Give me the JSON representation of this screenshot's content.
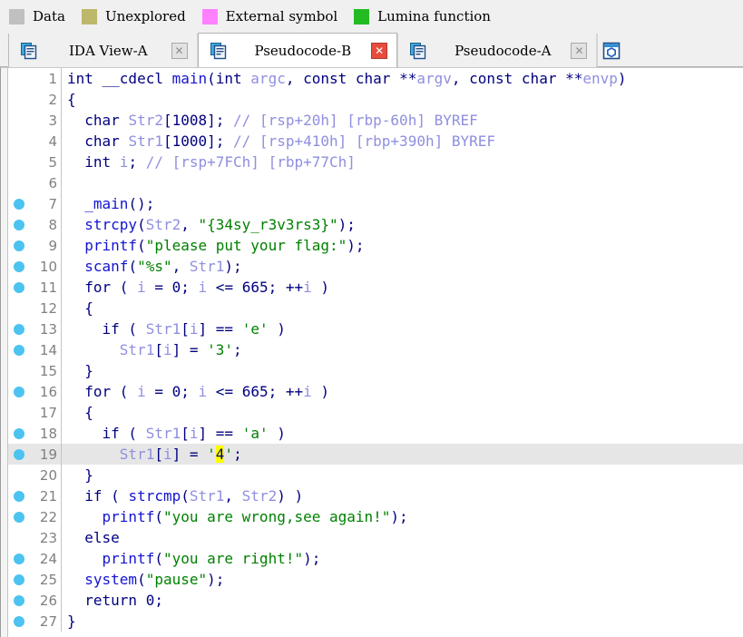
{
  "legend": {
    "items": [
      {
        "label": "Data",
        "color": "#c0c0c0",
        "icon": "color-swatch"
      },
      {
        "label": "Unexplored",
        "color": "#bdb76b",
        "icon": "color-swatch"
      },
      {
        "label": "External symbol",
        "color": "#ff80ff",
        "icon": "color-swatch"
      },
      {
        "label": "Lumina function",
        "color": "#22bb22",
        "icon": "color-swatch"
      }
    ]
  },
  "tabs": [
    {
      "title": "IDA View-A",
      "icon": "document-pages-icon",
      "close_label": "✕",
      "active": false,
      "close_style": "gray"
    },
    {
      "title": "Pseudocode-B",
      "icon": "document-pages-icon",
      "close_label": "✕",
      "active": true,
      "close_style": "red"
    },
    {
      "title": "Pseudocode-A",
      "icon": "document-pages-icon",
      "close_label": "✕",
      "active": false,
      "close_style": "gray"
    },
    {
      "title": "",
      "icon": "hex-view-icon",
      "close_label": "",
      "active": false,
      "close_style": "none"
    }
  ],
  "editor": {
    "selected_line": 19,
    "highlighted_token": "4",
    "lines": [
      {
        "n": 1,
        "bp": false,
        "text": "int __cdecl main(int argc, const char **argv, const char **envp)"
      },
      {
        "n": 2,
        "bp": false,
        "text": "{"
      },
      {
        "n": 3,
        "bp": false,
        "text": "  char Str2[1008]; // [rsp+20h] [rbp-60h] BYREF"
      },
      {
        "n": 4,
        "bp": false,
        "text": "  char Str1[1000]; // [rsp+410h] [rbp+390h] BYREF"
      },
      {
        "n": 5,
        "bp": false,
        "text": "  int i; // [rsp+7FCh] [rbp+77Ch]"
      },
      {
        "n": 6,
        "bp": false,
        "text": ""
      },
      {
        "n": 7,
        "bp": true,
        "text": "  _main();"
      },
      {
        "n": 8,
        "bp": true,
        "text": "  strcpy(Str2, \"{34sy_r3v3rs3}\");"
      },
      {
        "n": 9,
        "bp": true,
        "text": "  printf(\"please put your flag:\");"
      },
      {
        "n": 10,
        "bp": true,
        "text": "  scanf(\"%s\", Str1);"
      },
      {
        "n": 11,
        "bp": true,
        "text": "  for ( i = 0; i <= 665; ++i )"
      },
      {
        "n": 12,
        "bp": false,
        "text": "  {"
      },
      {
        "n": 13,
        "bp": true,
        "text": "    if ( Str1[i] == 'e' )"
      },
      {
        "n": 14,
        "bp": true,
        "text": "      Str1[i] = '3';"
      },
      {
        "n": 15,
        "bp": false,
        "text": "  }"
      },
      {
        "n": 16,
        "bp": true,
        "text": "  for ( i = 0; i <= 665; ++i )"
      },
      {
        "n": 17,
        "bp": false,
        "text": "  {"
      },
      {
        "n": 18,
        "bp": true,
        "text": "    if ( Str1[i] == 'a' )"
      },
      {
        "n": 19,
        "bp": true,
        "text": "      Str1[i] = '4';"
      },
      {
        "n": 20,
        "bp": false,
        "text": "  }"
      },
      {
        "n": 21,
        "bp": true,
        "text": "  if ( strcmp(Str1, Str2) )"
      },
      {
        "n": 22,
        "bp": true,
        "text": "    printf(\"you are wrong,see again!\");"
      },
      {
        "n": 23,
        "bp": false,
        "text": "  else"
      },
      {
        "n": 24,
        "bp": true,
        "text": "    printf(\"you are right!\");"
      },
      {
        "n": 25,
        "bp": true,
        "text": "  system(\"pause\");"
      },
      {
        "n": 26,
        "bp": true,
        "text": "  return 0;"
      },
      {
        "n": 27,
        "bp": true,
        "text": "}"
      }
    ],
    "rich": {
      "1": [
        [
          "kw",
          "int "
        ],
        [
          "kw",
          "__cdecl "
        ],
        [
          "fn",
          "main"
        ],
        [
          "pun",
          "("
        ],
        [
          "kw",
          "int "
        ],
        [
          "var",
          "argc"
        ],
        [
          "pun",
          ", "
        ],
        [
          "kw",
          "const char "
        ],
        [
          "pun",
          "**"
        ],
        [
          "var",
          "argv"
        ],
        [
          "pun",
          ", "
        ],
        [
          "kw",
          "const char "
        ],
        [
          "pun",
          "**"
        ],
        [
          "var",
          "envp"
        ],
        [
          "pun",
          ")"
        ]
      ],
      "2": [
        [
          "pun",
          "{"
        ]
      ],
      "3": [
        [
          "pun",
          "  "
        ],
        [
          "kw",
          "char "
        ],
        [
          "var",
          "Str2"
        ],
        [
          "pun",
          "[1008]; "
        ],
        [
          "cmt",
          "// [rsp+20h] [rbp-60h] BYREF"
        ]
      ],
      "4": [
        [
          "pun",
          "  "
        ],
        [
          "kw",
          "char "
        ],
        [
          "var",
          "Str1"
        ],
        [
          "pun",
          "[1000]; "
        ],
        [
          "cmt",
          "// [rsp+410h] [rbp+390h] BYREF"
        ]
      ],
      "5": [
        [
          "pun",
          "  "
        ],
        [
          "kw",
          "int "
        ],
        [
          "var",
          "i"
        ],
        [
          "pun",
          "; "
        ],
        [
          "cmt",
          "// [rsp+7FCh] [rbp+77Ch]"
        ]
      ],
      "6": [
        [
          "pun",
          ""
        ]
      ],
      "7": [
        [
          "pun",
          "  "
        ],
        [
          "fn",
          "_main"
        ],
        [
          "pun",
          "();"
        ]
      ],
      "8": [
        [
          "pun",
          "  "
        ],
        [
          "fn",
          "strcpy"
        ],
        [
          "pun",
          "("
        ],
        [
          "var",
          "Str2"
        ],
        [
          "pun",
          ", "
        ],
        [
          "str",
          "\"{34sy_r3v3rs3}\""
        ],
        [
          "pun",
          ");"
        ]
      ],
      "9": [
        [
          "pun",
          "  "
        ],
        [
          "fn",
          "printf"
        ],
        [
          "pun",
          "("
        ],
        [
          "str",
          "\"please put your flag:\""
        ],
        [
          "pun",
          ");"
        ]
      ],
      "10": [
        [
          "pun",
          "  "
        ],
        [
          "fn",
          "scanf"
        ],
        [
          "pun",
          "("
        ],
        [
          "str",
          "\"%s\""
        ],
        [
          "pun",
          ", "
        ],
        [
          "var",
          "Str1"
        ],
        [
          "pun",
          ");"
        ]
      ],
      "11": [
        [
          "pun",
          "  "
        ],
        [
          "kw",
          "for"
        ],
        [
          "pun",
          " ( "
        ],
        [
          "var",
          "i"
        ],
        [
          "pun",
          " = "
        ],
        [
          "num",
          "0"
        ],
        [
          "pun",
          "; "
        ],
        [
          "var",
          "i"
        ],
        [
          "pun",
          " <= "
        ],
        [
          "num",
          "665"
        ],
        [
          "pun",
          "; ++"
        ],
        [
          "var",
          "i"
        ],
        [
          "pun",
          " )"
        ]
      ],
      "12": [
        [
          "pun",
          "  {"
        ]
      ],
      "13": [
        [
          "pun",
          "    "
        ],
        [
          "kw",
          "if"
        ],
        [
          "pun",
          " ( "
        ],
        [
          "var",
          "Str1"
        ],
        [
          "pun",
          "["
        ],
        [
          "var",
          "i"
        ],
        [
          "pun",
          "] == "
        ],
        [
          "str",
          "'e'"
        ],
        [
          "pun",
          " )"
        ]
      ],
      "14": [
        [
          "pun",
          "      "
        ],
        [
          "var",
          "Str1"
        ],
        [
          "pun",
          "["
        ],
        [
          "var",
          "i"
        ],
        [
          "pun",
          "] = "
        ],
        [
          "str",
          "'3'"
        ],
        [
          "pun",
          ";"
        ]
      ],
      "15": [
        [
          "pun",
          "  }"
        ]
      ],
      "16": [
        [
          "pun",
          "  "
        ],
        [
          "kw",
          "for"
        ],
        [
          "pun",
          " ( "
        ],
        [
          "var",
          "i"
        ],
        [
          "pun",
          " = "
        ],
        [
          "num",
          "0"
        ],
        [
          "pun",
          "; "
        ],
        [
          "var",
          "i"
        ],
        [
          "pun",
          " <= "
        ],
        [
          "num",
          "665"
        ],
        [
          "pun",
          "; ++"
        ],
        [
          "var",
          "i"
        ],
        [
          "pun",
          " )"
        ]
      ],
      "17": [
        [
          "pun",
          "  {"
        ]
      ],
      "18": [
        [
          "pun",
          "    "
        ],
        [
          "kw",
          "if"
        ],
        [
          "pun",
          " ( "
        ],
        [
          "var",
          "Str1"
        ],
        [
          "pun",
          "["
        ],
        [
          "var",
          "i"
        ],
        [
          "pun",
          "] == "
        ],
        [
          "str",
          "'a'"
        ],
        [
          "pun",
          " )"
        ]
      ],
      "19": [
        [
          "pun",
          "      "
        ],
        [
          "var",
          "Str1"
        ],
        [
          "pun",
          "["
        ],
        [
          "var",
          "i"
        ],
        [
          "pun",
          "] = "
        ],
        [
          "str",
          "'"
        ],
        [
          "hl",
          "4"
        ],
        [
          "str",
          "'"
        ],
        [
          "pun",
          ";"
        ]
      ],
      "20": [
        [
          "pun",
          "  }"
        ]
      ],
      "21": [
        [
          "pun",
          "  "
        ],
        [
          "kw",
          "if"
        ],
        [
          "pun",
          " ( "
        ],
        [
          "fn",
          "strcmp"
        ],
        [
          "pun",
          "("
        ],
        [
          "var",
          "Str1"
        ],
        [
          "pun",
          ", "
        ],
        [
          "var",
          "Str2"
        ],
        [
          "pun",
          ") )"
        ]
      ],
      "22": [
        [
          "pun",
          "    "
        ],
        [
          "fn",
          "printf"
        ],
        [
          "pun",
          "("
        ],
        [
          "str",
          "\"you are wrong,see again!\""
        ],
        [
          "pun",
          ");"
        ]
      ],
      "23": [
        [
          "pun",
          "  "
        ],
        [
          "kw",
          "else"
        ]
      ],
      "24": [
        [
          "pun",
          "    "
        ],
        [
          "fn",
          "printf"
        ],
        [
          "pun",
          "("
        ],
        [
          "str",
          "\"you are right!\""
        ],
        [
          "pun",
          ");"
        ]
      ],
      "25": [
        [
          "pun",
          "  "
        ],
        [
          "fn",
          "system"
        ],
        [
          "pun",
          "("
        ],
        [
          "str",
          "\"pause\""
        ],
        [
          "pun",
          ");"
        ]
      ],
      "26": [
        [
          "pun",
          "  "
        ],
        [
          "kw",
          "return "
        ],
        [
          "num",
          "0"
        ],
        [
          "pun",
          ";"
        ]
      ],
      "27": [
        [
          "pun",
          "}"
        ]
      ]
    }
  }
}
